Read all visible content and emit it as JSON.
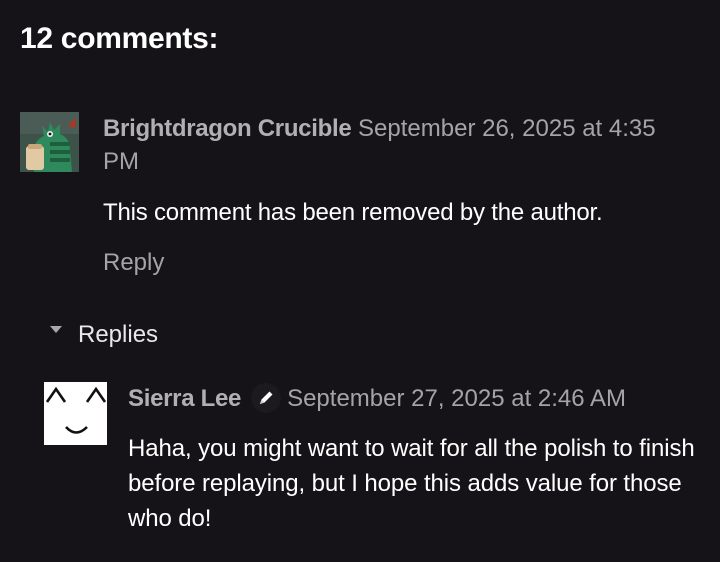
{
  "comments_section": {
    "heading": "12 comments:",
    "comments": [
      {
        "author": "Brightdragon Crucible",
        "date": "September 26, 2025 at 4:35 PM",
        "body": "This comment has been removed by the author.",
        "reply_label": "Reply",
        "avatar": "dragon-avatar-icon"
      }
    ],
    "replies_toggle_label": "Replies",
    "replies": [
      {
        "author": "Sierra Lee",
        "author_badge": "pencil-icon",
        "date": "September 27, 2025 at 2:46 AM",
        "body": "Haha, you might want to wait for all the polish to finish before replaying, but I hope this adds value for those who do!",
        "avatar": "smiley-face-avatar-icon"
      }
    ]
  },
  "colors": {
    "background": "#151317",
    "text_primary": "#ffffff",
    "text_muted": "#a4a4a6"
  }
}
